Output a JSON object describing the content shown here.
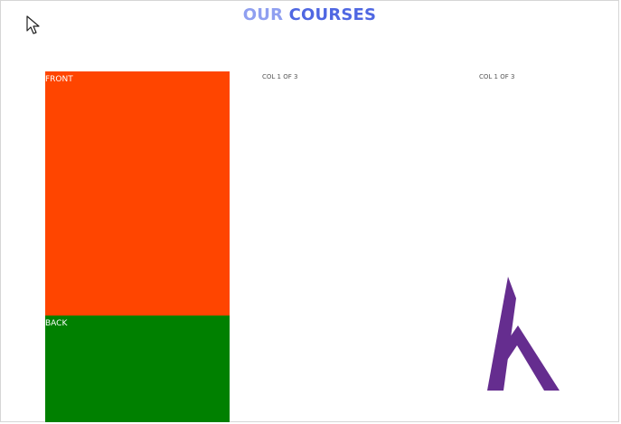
{
  "page": {
    "heading": {
      "light": "OUR ",
      "strong": "COURSES"
    }
  },
  "cards": {
    "front_label": "FRONT",
    "back_label": "BACK"
  },
  "columns": [
    {
      "label": "COL 1 OF 3"
    },
    {
      "label": "COL 1 OF 3"
    }
  ],
  "colors": {
    "heading_light": "#8f9ff0",
    "heading_strong": "#4f67e2",
    "front_card": "#ff4500",
    "back_card": "#008000",
    "logo": "#652d8f"
  },
  "icons": {
    "cursor": "arrow-cursor-icon",
    "logo": "purple-h-logo-icon"
  }
}
